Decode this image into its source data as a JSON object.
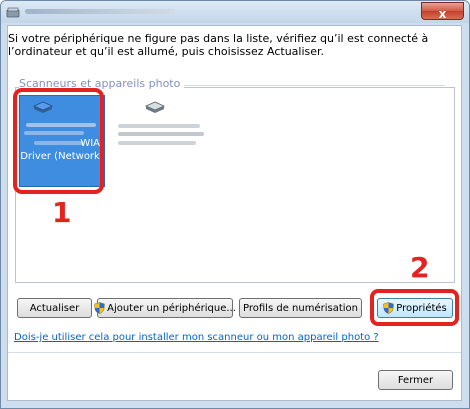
{
  "window": {
    "close_glyph": "x"
  },
  "instruction": "Si votre périphérique ne figure pas dans la liste, vérifiez qu’il est connecté à l’ordinateur et qu’il est allumé, puis choisissez Actualiser.",
  "device_list": {
    "group_title": "Scanneurs et appareils photo",
    "devices": [
      {
        "label_line1": "WIA",
        "label_line2": "Driver (Network)",
        "selected": true
      },
      {
        "selected": false
      }
    ]
  },
  "callouts": {
    "one": "1",
    "two": "2",
    "color": "#e42320"
  },
  "buttons": {
    "refresh": "Actualiser",
    "add_device": "Ajouter un périphérique...",
    "scan_profiles": "Profils de numérisation",
    "properties": "Propriétés",
    "close": "Fermer"
  },
  "help_link": "Dois-je utiliser cela pour installer mon scanneur ou mon appareil photo ?",
  "colors": {
    "selection": "#3e8de0",
    "link": "#0066cc"
  },
  "icons": {
    "app": "scanner-app-icon",
    "device": "scanner-icon",
    "admin": "uac-shield-icon"
  }
}
